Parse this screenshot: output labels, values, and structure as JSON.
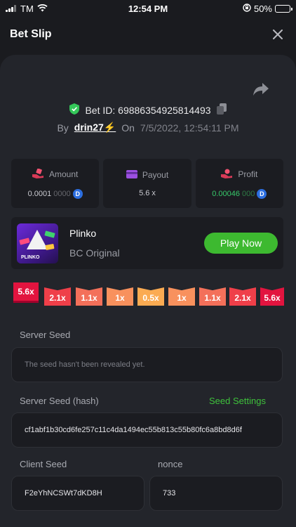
{
  "status_bar": {
    "carrier": "TM",
    "time": "12:54 PM",
    "battery": "50%",
    "battery_level": 0.5
  },
  "header": {
    "title": "Bet Slip"
  },
  "bet": {
    "id_label": "Bet ID: 69886354925814493",
    "by_label": "By",
    "user": "drin27⚡",
    "on_label": "On",
    "date": "7/5/2022, 12:54:11 PM"
  },
  "stats": [
    {
      "label": "Amount",
      "value_main": "0.0001",
      "value_dim": "0000",
      "coin": true,
      "icon": "hand-coins-icon"
    },
    {
      "label": "Payout",
      "value_main": "5.6 x",
      "value_dim": "",
      "coin": false,
      "icon": "card-icon"
    },
    {
      "label": "Profit",
      "value_main": "0.00046",
      "value_dim": "000",
      "coin": true,
      "icon": "profit-hand-icon"
    }
  ],
  "game": {
    "thumb_text": "PLINKO",
    "name": "Plinko",
    "provider": "BC Original",
    "play_label": "Play Now"
  },
  "multipliers": [
    {
      "label": "5.6x",
      "color": "#e2143f"
    },
    {
      "label": "2.1x",
      "color": "#ef3f49"
    },
    {
      "label": "1.1x",
      "color": "#f3705a"
    },
    {
      "label": "1x",
      "color": "#f8915d"
    },
    {
      "label": "0.5x",
      "color": "#fbab52"
    },
    {
      "label": "1x",
      "color": "#f8915d"
    },
    {
      "label": "1.1x",
      "color": "#f3705a"
    },
    {
      "label": "2.1x",
      "color": "#ef3f49"
    },
    {
      "label": "5.6x",
      "color": "#e2143f"
    }
  ],
  "server_seed": {
    "label": "Server Seed",
    "value": "The seed hasn't been revealed yet."
  },
  "server_seed_hash": {
    "label": "Server Seed (hash)",
    "link": "Seed Settings",
    "value": "cf1abf1b30cd6fe257c11c4da1494ec55b813c55b80fc6a8bd8d6f"
  },
  "client_seed": {
    "label": "Client Seed",
    "value": "F2eYhNCSWt7dKD8H"
  },
  "nonce": {
    "label": "nonce",
    "value": "733"
  },
  "colors": {
    "accent_green": "#3db930",
    "profit_green": "#37c96a",
    "coin_blue": "#2c6ee0",
    "shield_green": "#34c759"
  }
}
